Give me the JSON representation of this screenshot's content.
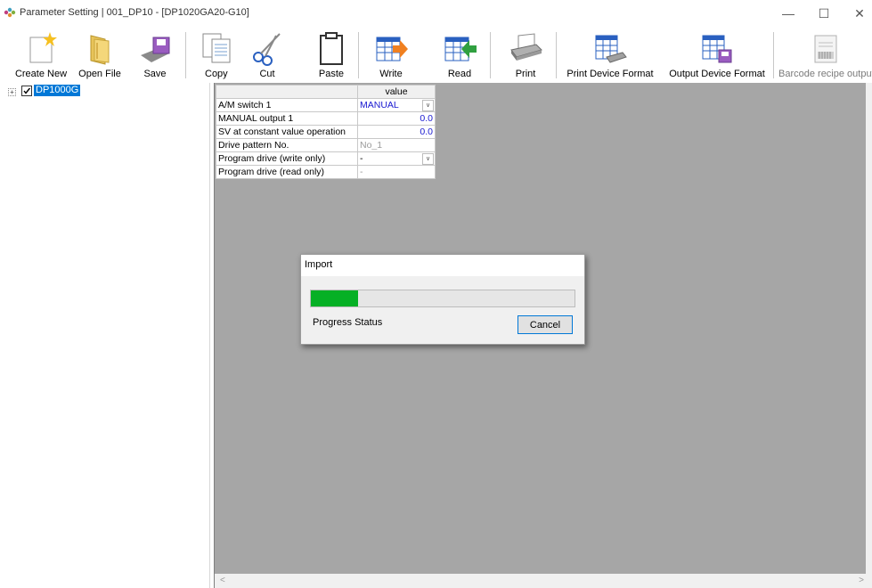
{
  "window": {
    "title": "Parameter Setting  | 001_DP10 - [DP1020GA20-G10]",
    "minimize": "—",
    "maximize": "☐",
    "close": "✕"
  },
  "toolbar": {
    "create_new": "Create New",
    "open_file": "Open File",
    "save": "Save",
    "copy": "Copy",
    "cut": "Cut",
    "paste": "Paste",
    "write": "Write",
    "read": "Read",
    "print": "Print",
    "print_device_format": "Print Device Format",
    "output_device_format": "Output Device Format",
    "barcode_recipe_output": "Barcode recipe output"
  },
  "tree": {
    "expander": "+",
    "root_label": "DP1000G",
    "root_checked": true
  },
  "grid": {
    "column_header": "value",
    "rows": [
      {
        "name": "A/M switch 1",
        "value": "MANUAL"
      },
      {
        "name": "MANUAL output 1",
        "value": "0.0"
      },
      {
        "name": "SV at constant value operation",
        "value": "0.0"
      },
      {
        "name": "Drive pattern No.",
        "value": "No_1"
      },
      {
        "name": "Program drive (write only)",
        "value": "-"
      },
      {
        "name": "Program drive (read only)",
        "value": "-"
      }
    ],
    "dropdown_glyph": "∨"
  },
  "scrollbar": {
    "left_arrow": "<",
    "right_arrow": ">"
  },
  "dialog": {
    "title": "Import",
    "progress_fraction": 0.18,
    "status_label": "Progress Status",
    "cancel_label": "Cancel"
  },
  "colors": {
    "selection": "#0078d7",
    "progress": "#06b025",
    "panel_gray": "#a6a6a6",
    "value_blue": "#1818d0"
  }
}
